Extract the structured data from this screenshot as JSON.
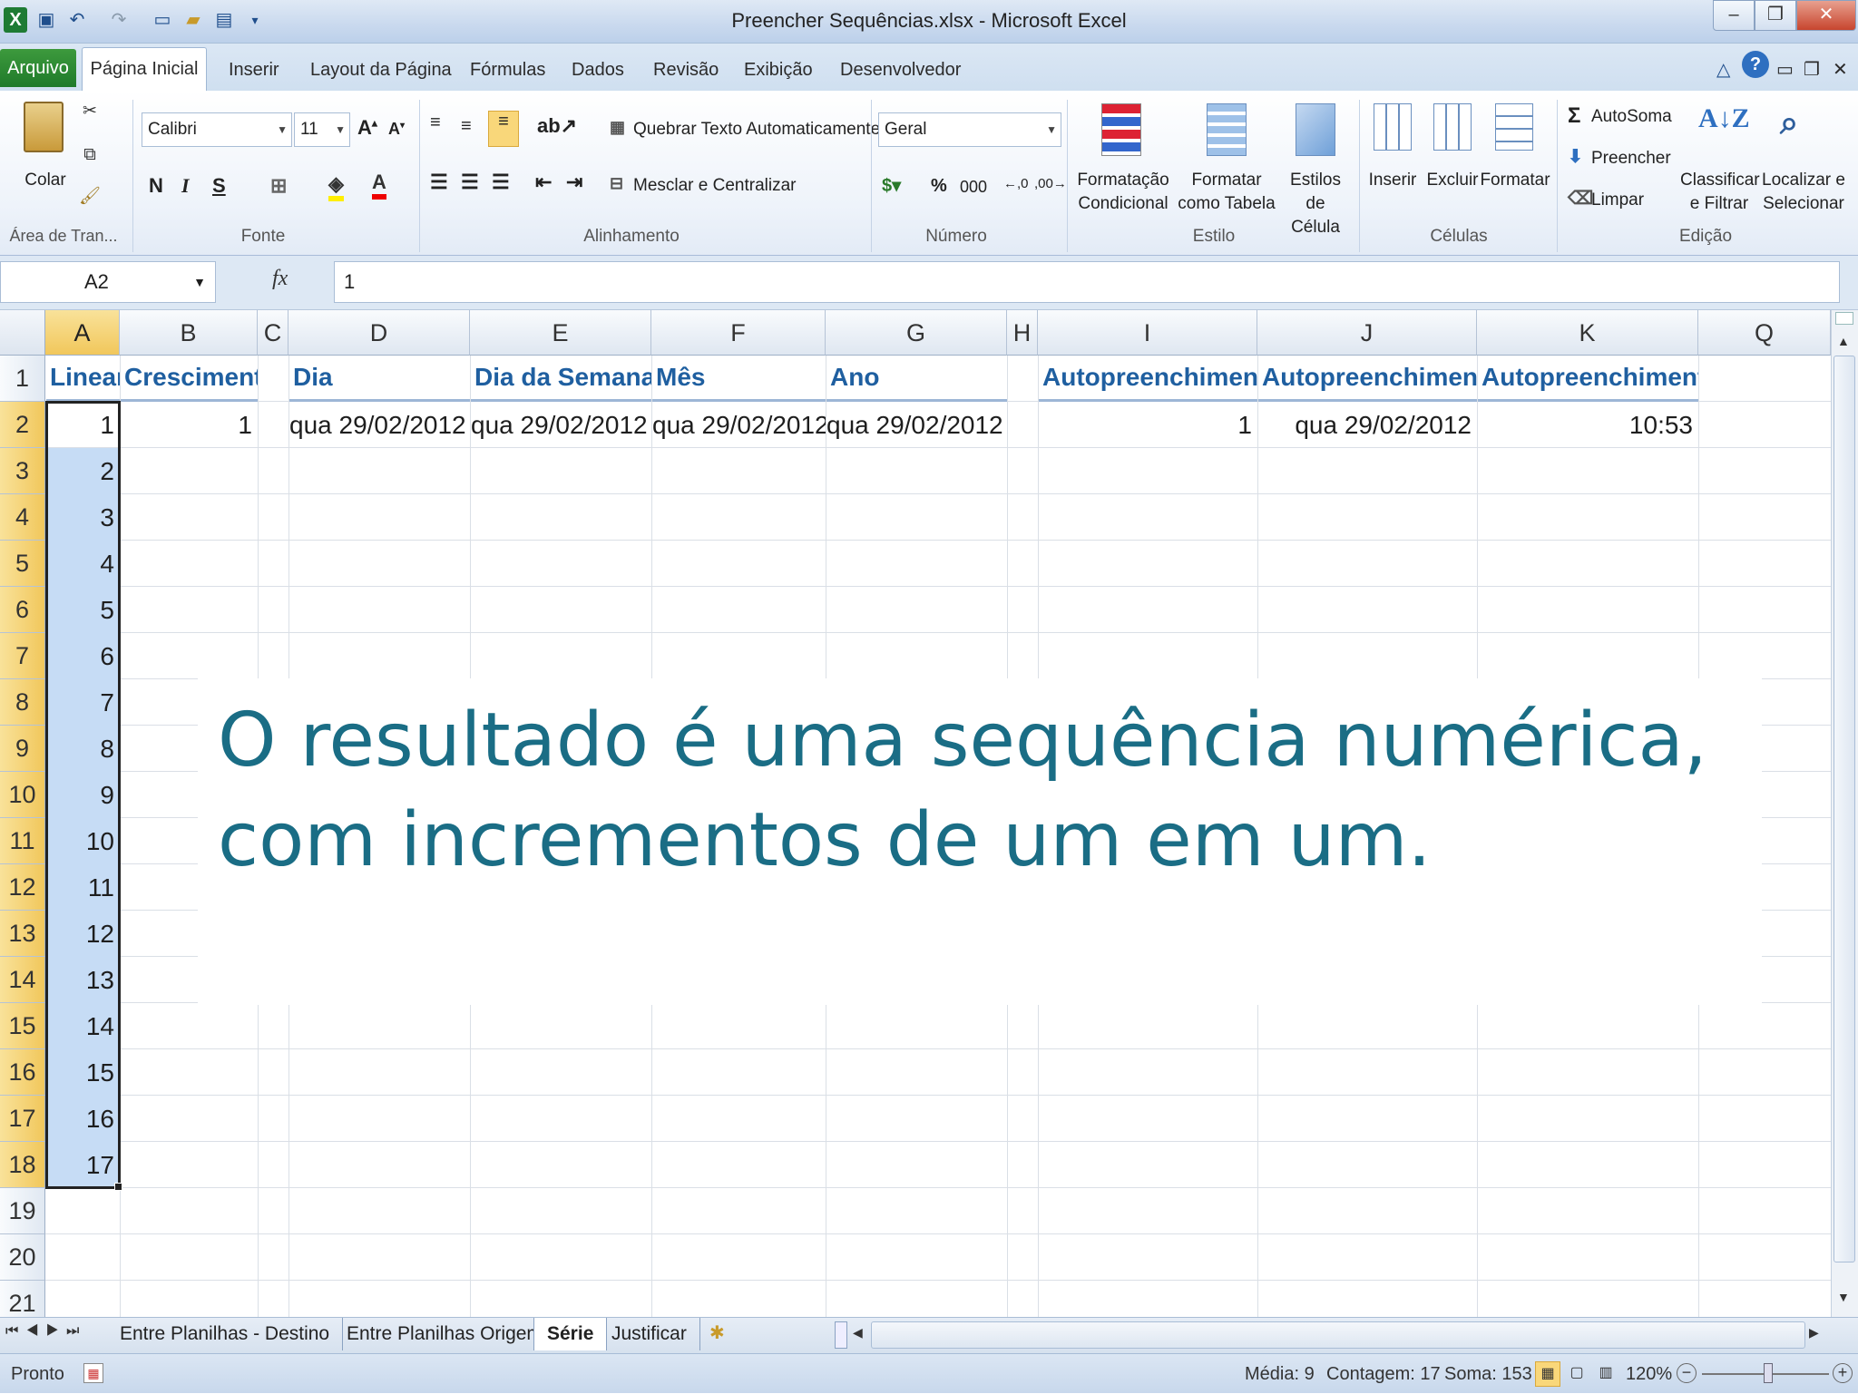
{
  "window": {
    "title": "Preencher Sequências.xlsx - Microsoft Excel"
  },
  "tabs": [
    "Arquivo",
    "Página Inicial",
    "Inserir",
    "Layout da Página",
    "Fórmulas",
    "Dados",
    "Revisão",
    "Exibição",
    "Desenvolvedor"
  ],
  "ribbon": {
    "clipboard": {
      "paste": "Colar",
      "label": "Área de Tran..."
    },
    "font": {
      "name": "Calibri",
      "size": "11",
      "bold": "N",
      "italic": "I",
      "underline": "S",
      "label": "Fonte"
    },
    "alignment": {
      "wrap": "Quebrar Texto Automaticamente",
      "merge": "Mesclar e Centralizar",
      "label": "Alinhamento"
    },
    "number": {
      "format": "Geral",
      "percent": "%",
      "thousands": "000",
      "label": "Número"
    },
    "styles": {
      "conditional": "Formatação Condicional",
      "as_table": "Formatar como Tabela",
      "cell_styles": "Estilos de Célula",
      "label": "Estilo"
    },
    "cells": {
      "insert": "Inserir",
      "delete": "Excluir",
      "format": "Formatar",
      "label": "Células"
    },
    "editing": {
      "autosum": "AutoSoma",
      "fill": "Preencher",
      "clear": "Limpar",
      "sort": "Classificar e Filtrar",
      "find": "Localizar e Selecionar",
      "label": "Edição"
    }
  },
  "formula_bar": {
    "name_box": "A2",
    "fx": "fx",
    "value": "1"
  },
  "columns": [
    "A",
    "B",
    "C",
    "D",
    "E",
    "F",
    "G",
    "H",
    "I",
    "J",
    "K",
    "Q"
  ],
  "rows": [
    "1",
    "2",
    "3",
    "4",
    "5",
    "6",
    "7",
    "8",
    "9",
    "10",
    "11",
    "12",
    "13",
    "14",
    "15",
    "16",
    "17",
    "18",
    "19",
    "20",
    "21"
  ],
  "headers": {
    "A": "Linear",
    "B": "Crescimento",
    "D": "Dia",
    "E": "Dia da Semana",
    "F": "Mês",
    "G": "Ano",
    "I": "Autopreenchimento",
    "J": "Autopreenchimento",
    "K": "Autopreenchimento"
  },
  "row2": {
    "A": "1",
    "B": "1",
    "D": "qua 29/02/2012",
    "E": "qua 29/02/2012",
    "F": "qua 29/02/2012",
    "G": "qua 29/02/2012",
    "I": "1",
    "J": "qua 29/02/2012",
    "K": "10:53"
  },
  "colA_values": [
    "2",
    "3",
    "4",
    "5",
    "6",
    "7",
    "8",
    "9",
    "10",
    "11",
    "12",
    "13",
    "14",
    "15",
    "16",
    "17"
  ],
  "overlay": {
    "line1": "O resultado é uma sequência numérica,",
    "line2": "com incrementos de um em um."
  },
  "sheets": [
    "Entre Planilhas - Destino",
    "Entre Planilhas Origem",
    "Série",
    "Justificar"
  ],
  "status": {
    "ready": "Pronto",
    "average": "Média: 9",
    "count": "Contagem: 17",
    "sum": "Soma: 153",
    "zoom": "120%"
  }
}
